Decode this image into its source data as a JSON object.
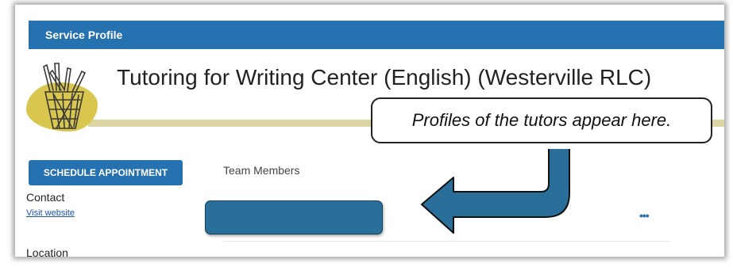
{
  "header": {
    "title": "Service Profile"
  },
  "service": {
    "name": "Tutoring for Writing Center (English) (Westerville RLC)"
  },
  "callout": {
    "text": "Profiles of the tutors appear here."
  },
  "actions": {
    "schedule_label": "SCHEDULE APPOINTMENT"
  },
  "team": {
    "title": "Team Members"
  },
  "contact": {
    "heading": "Contact",
    "link_label": "Visit website"
  },
  "location": {
    "heading": "Location"
  },
  "menu": {
    "more_glyph": "•••"
  },
  "colors": {
    "brand_blue": "#2671b0",
    "card_teal": "#2a6f99",
    "logo_yellow": "#d8c64e",
    "beige_bar": "#dcd4a3"
  }
}
